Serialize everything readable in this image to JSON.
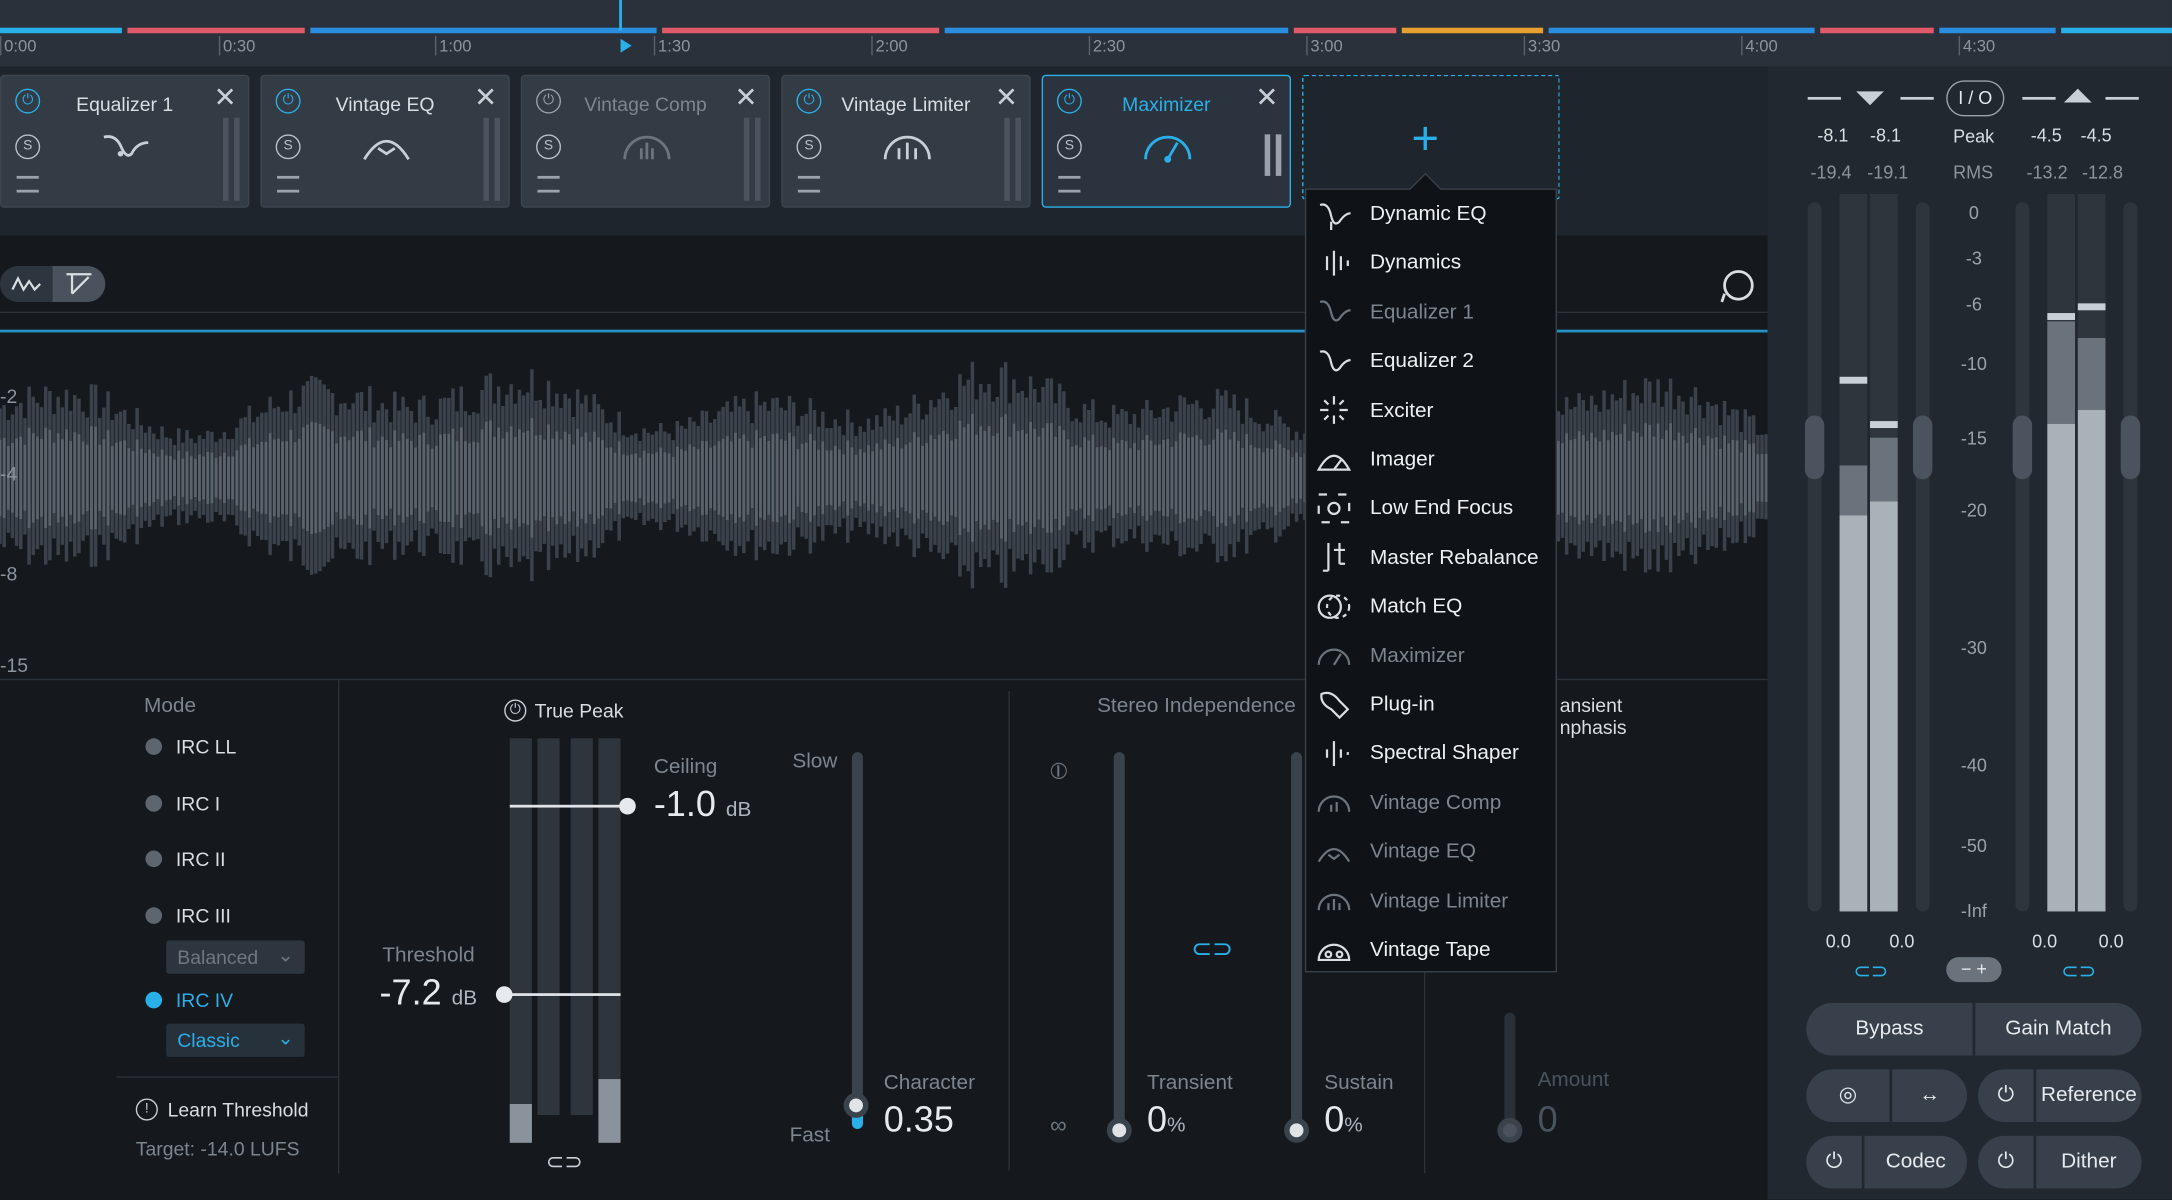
{
  "timeline": {
    "ticks": [
      "0:00",
      "0:30",
      "1:00",
      "1:30",
      "2:00",
      "2:30",
      "3:00",
      "3:30",
      "4:00",
      "4:30"
    ]
  },
  "modules": [
    {
      "name": "Equalizer 1",
      "icon": "eq-curve-icon",
      "state": "active"
    },
    {
      "name": "Vintage EQ",
      "icon": "vintage-eq-icon",
      "state": "active"
    },
    {
      "name": "Vintage Comp",
      "icon": "vintage-comp-icon",
      "state": "bypassed"
    },
    {
      "name": "Vintage Limiter",
      "icon": "vintage-limiter-icon",
      "state": "active"
    },
    {
      "name": "Maximizer",
      "icon": "gauge-icon",
      "state": "selected"
    }
  ],
  "add_module": {
    "icon": "plus-icon"
  },
  "menu": {
    "items": [
      {
        "label": "Dynamic EQ",
        "enabled": true,
        "icon": "dynamic-eq-icon"
      },
      {
        "label": "Dynamics",
        "enabled": true,
        "icon": "dynamics-icon"
      },
      {
        "label": "Equalizer 1",
        "enabled": false,
        "icon": "eq-curve-icon"
      },
      {
        "label": "Equalizer 2",
        "enabled": true,
        "icon": "eq-curve-icon"
      },
      {
        "label": "Exciter",
        "enabled": true,
        "icon": "exciter-icon"
      },
      {
        "label": "Imager",
        "enabled": true,
        "icon": "imager-icon"
      },
      {
        "label": "Low End Focus",
        "enabled": true,
        "icon": "low-end-focus-icon"
      },
      {
        "label": "Master Rebalance",
        "enabled": true,
        "icon": "master-rebalance-icon"
      },
      {
        "label": "Match EQ",
        "enabled": true,
        "icon": "match-eq-icon"
      },
      {
        "label": "Maximizer",
        "enabled": false,
        "icon": "gauge-icon"
      },
      {
        "label": "Plug-in",
        "enabled": true,
        "icon": "plugin-icon"
      },
      {
        "label": "Spectral Shaper",
        "enabled": true,
        "icon": "spectral-shaper-icon"
      },
      {
        "label": "Vintage Comp",
        "enabled": false,
        "icon": "vintage-comp-icon"
      },
      {
        "label": "Vintage EQ",
        "enabled": false,
        "icon": "vintage-eq-icon"
      },
      {
        "label": "Vintage Limiter",
        "enabled": false,
        "icon": "vintage-limiter-icon"
      },
      {
        "label": "Vintage Tape",
        "enabled": true,
        "icon": "vintage-tape-icon"
      }
    ]
  },
  "wave_scale": [
    "-2",
    "-4",
    "-8",
    "-15"
  ],
  "maximizer": {
    "mode_label": "Mode",
    "modes": [
      {
        "label": "IRC LL",
        "on": false
      },
      {
        "label": "IRC I",
        "on": false
      },
      {
        "label": "IRC II",
        "on": false
      },
      {
        "label": "IRC III",
        "on": false
      },
      {
        "label": "IRC IV",
        "on": true
      }
    ],
    "irc3_style": "Balanced",
    "irc4_style": "Classic",
    "learn_threshold": "Learn Threshold",
    "target": "Target: -14.0 LUFS",
    "true_peak": "True Peak",
    "ceiling_label": "Ceiling",
    "ceiling_value": "-1.0",
    "ceiling_unit": "dB",
    "threshold_label": "Threshold",
    "threshold_value": "-7.2",
    "threshold_unit": "dB",
    "slow": "Slow",
    "fast": "Fast",
    "character_label": "Character",
    "character_value": "0.35",
    "stereo_independence": "Stereo Independence",
    "transient_label": "Transient",
    "transient_value": "0",
    "transient_unit": "%",
    "sustain_label": "Sustain",
    "sustain_value": "0",
    "sustain_unit": "%",
    "transient_emphasis_1": "ansient",
    "transient_emphasis_2": "nphasis",
    "amount_label": "Amount",
    "amount_value": "0"
  },
  "meters": {
    "in_peak_l": "-8.1",
    "in_peak_r": "-8.1",
    "in_rms_l": "-19.4",
    "in_rms_r": "-19.1",
    "out_peak_l": "-4.5",
    "out_peak_r": "-4.5",
    "out_rms_l": "-13.2",
    "out_rms_r": "-12.8",
    "io_label": "I / O",
    "peak_label": "Peak",
    "rms_label": "RMS",
    "scale": [
      "0",
      "-3",
      "-6",
      "-10",
      "-15",
      "-20",
      "-30",
      "-40",
      "-50",
      "-Inf"
    ],
    "in_gain_l": "0.0",
    "in_gain_r": "0.0",
    "out_gain_l": "0.0",
    "out_gain_r": "0.0"
  },
  "footer": {
    "bypass": "Bypass",
    "gain_match": "Gain Match",
    "reference": "Reference",
    "codec": "Codec",
    "dither": "Dither"
  }
}
